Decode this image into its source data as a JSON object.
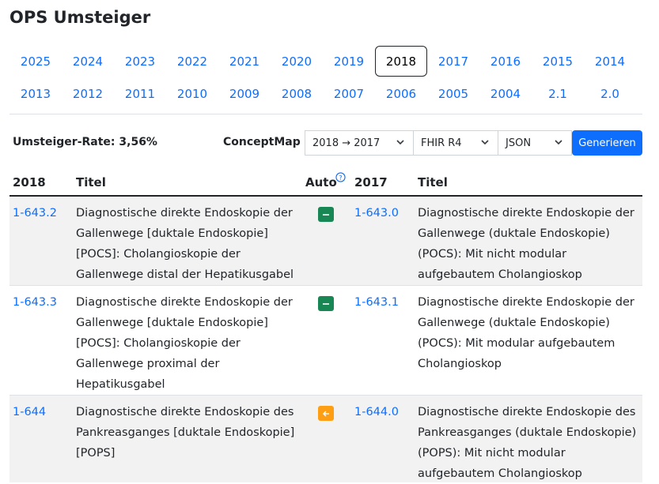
{
  "page": {
    "title": "OPS Umsteiger"
  },
  "years": {
    "row1": [
      "2025",
      "2024",
      "2023",
      "2022",
      "2021",
      "2020",
      "2019",
      "2018",
      "2017",
      "2016",
      "2015",
      "2014"
    ],
    "row2": [
      "2013",
      "2012",
      "2011",
      "2010",
      "2009",
      "2008",
      "2007",
      "2006",
      "2005",
      "2004",
      "2.1",
      "2.0"
    ],
    "active": "2018"
  },
  "controls": {
    "rate": "Umsteiger-Rate: 3,56%",
    "conceptmap_label": "ConceptMap",
    "direction": "2018 → 2017",
    "fhir": "FHIR R4",
    "format": "JSON",
    "generate": "Generieren"
  },
  "table": {
    "headers": {
      "from": "2018",
      "title1": "Titel",
      "auto": "Auto",
      "to": "2017",
      "title2": "Titel"
    },
    "rows": [
      {
        "from_code": "1-643.2",
        "from_title": [
          "Diagnostische direkte Endoskopie der",
          "Gallenwege [duktale Endoskopie]",
          "[POCS]: Cholangioskopie der",
          "Gallenwege distal der Hepatikusgabel"
        ],
        "auto": "minus",
        "to_code": "1-643.0",
        "to_title": [
          "Diagnostische direkte Endoskopie der",
          "Gallenwege (duktale Endoskopie)",
          "(POCS): Mit nicht modular",
          "aufgebautem Cholangioskop"
        ]
      },
      {
        "from_code": "1-643.3",
        "from_title": [
          "Diagnostische direkte Endoskopie der",
          "Gallenwege [duktale Endoskopie]",
          "[POCS]: Cholangioskopie der",
          "Gallenwege proximal der",
          "Hepatikusgabel"
        ],
        "auto": "minus",
        "to_code": "1-643.1",
        "to_title": [
          "Diagnostische direkte Endoskopie der",
          "Gallenwege (duktale Endoskopie)",
          "(POCS): Mit modular aufgebautem",
          "Cholangioskop"
        ]
      },
      {
        "from_code": "1-644",
        "from_title": [
          "Diagnostische direkte Endoskopie des",
          "Pankreasganges [duktale Endoskopie]",
          "[POPS]"
        ],
        "auto": "arrow-left",
        "to_code": "1-644.0",
        "to_title": [
          "Diagnostische direkte Endoskopie des",
          "Pankreasganges (duktale Endoskopie)",
          "(POPS): Mit nicht modular",
          "aufgebautem Cholangioskop"
        ]
      }
    ]
  }
}
